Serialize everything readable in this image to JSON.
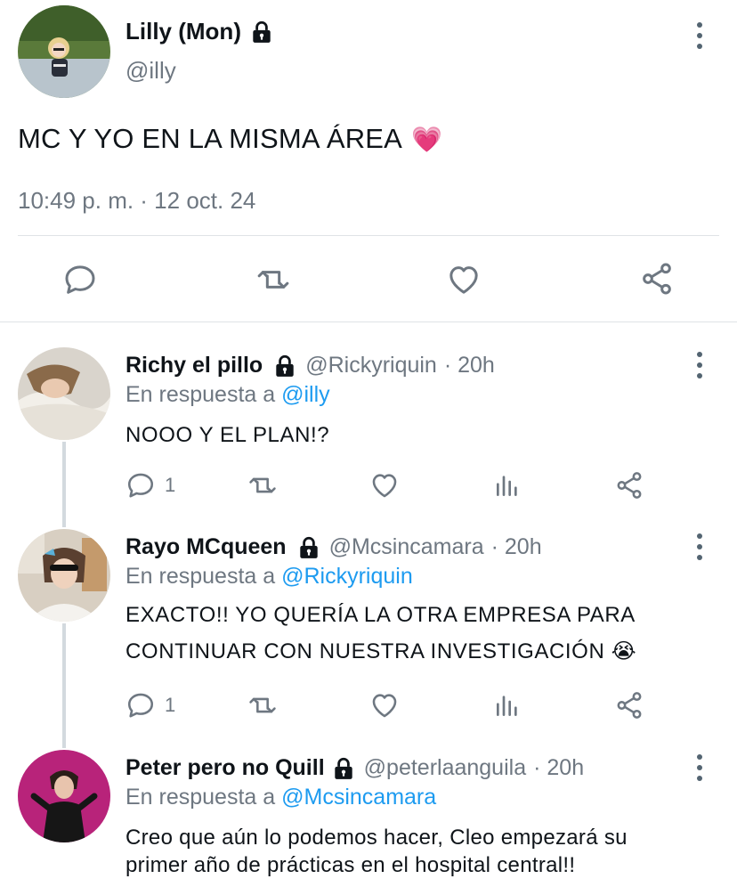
{
  "main_tweet": {
    "display_name": "Lilly (Mon)",
    "handle": "@illy",
    "text": "MC Y YO EN LA MISMA ÁREA",
    "emoji": "💗",
    "timestamp": "10:49 p. m. · 12 oct. 24"
  },
  "reply_prefix": "En respuesta a",
  "replies": [
    {
      "display_name": "Richy el pillo",
      "handle": "@Rickyriquin",
      "time": "· 20h",
      "reply_to": "@illy",
      "text_lines": [
        "NOOO Y EL PLAN!?"
      ],
      "reply_count": "1"
    },
    {
      "display_name": "Rayo MCqueen",
      "handle": "@Mcsincamara",
      "time": "· 20h",
      "reply_to": "@Rickyriquin",
      "text_lines": [
        "EXACTO!! YO QUERÍA LA OTRA EMPRESA PARA",
        "CONTINUAR CON NUESTRA INVESTIGACIÓN 😭"
      ],
      "reply_count": "1"
    },
    {
      "display_name": "Peter pero no Quill",
      "handle": "@peterlaanguila",
      "time": "· 20h",
      "reply_to": "@Mcsincamara",
      "text_lines": [
        "Creo que aún lo podemos hacer, Cleo empezará su",
        "primer año de prácticas en el hospital central!!"
      ]
    }
  ],
  "icons": {
    "reply": "reply-icon",
    "retweet": "retweet-icon",
    "like": "heart-icon",
    "share": "share-icon",
    "views": "views-icon",
    "lock": "lock-icon",
    "more": "more-icon"
  },
  "colors": {
    "link": "#1d9bf0",
    "secondary": "#6e7781",
    "divider": "#dfe3e6"
  }
}
